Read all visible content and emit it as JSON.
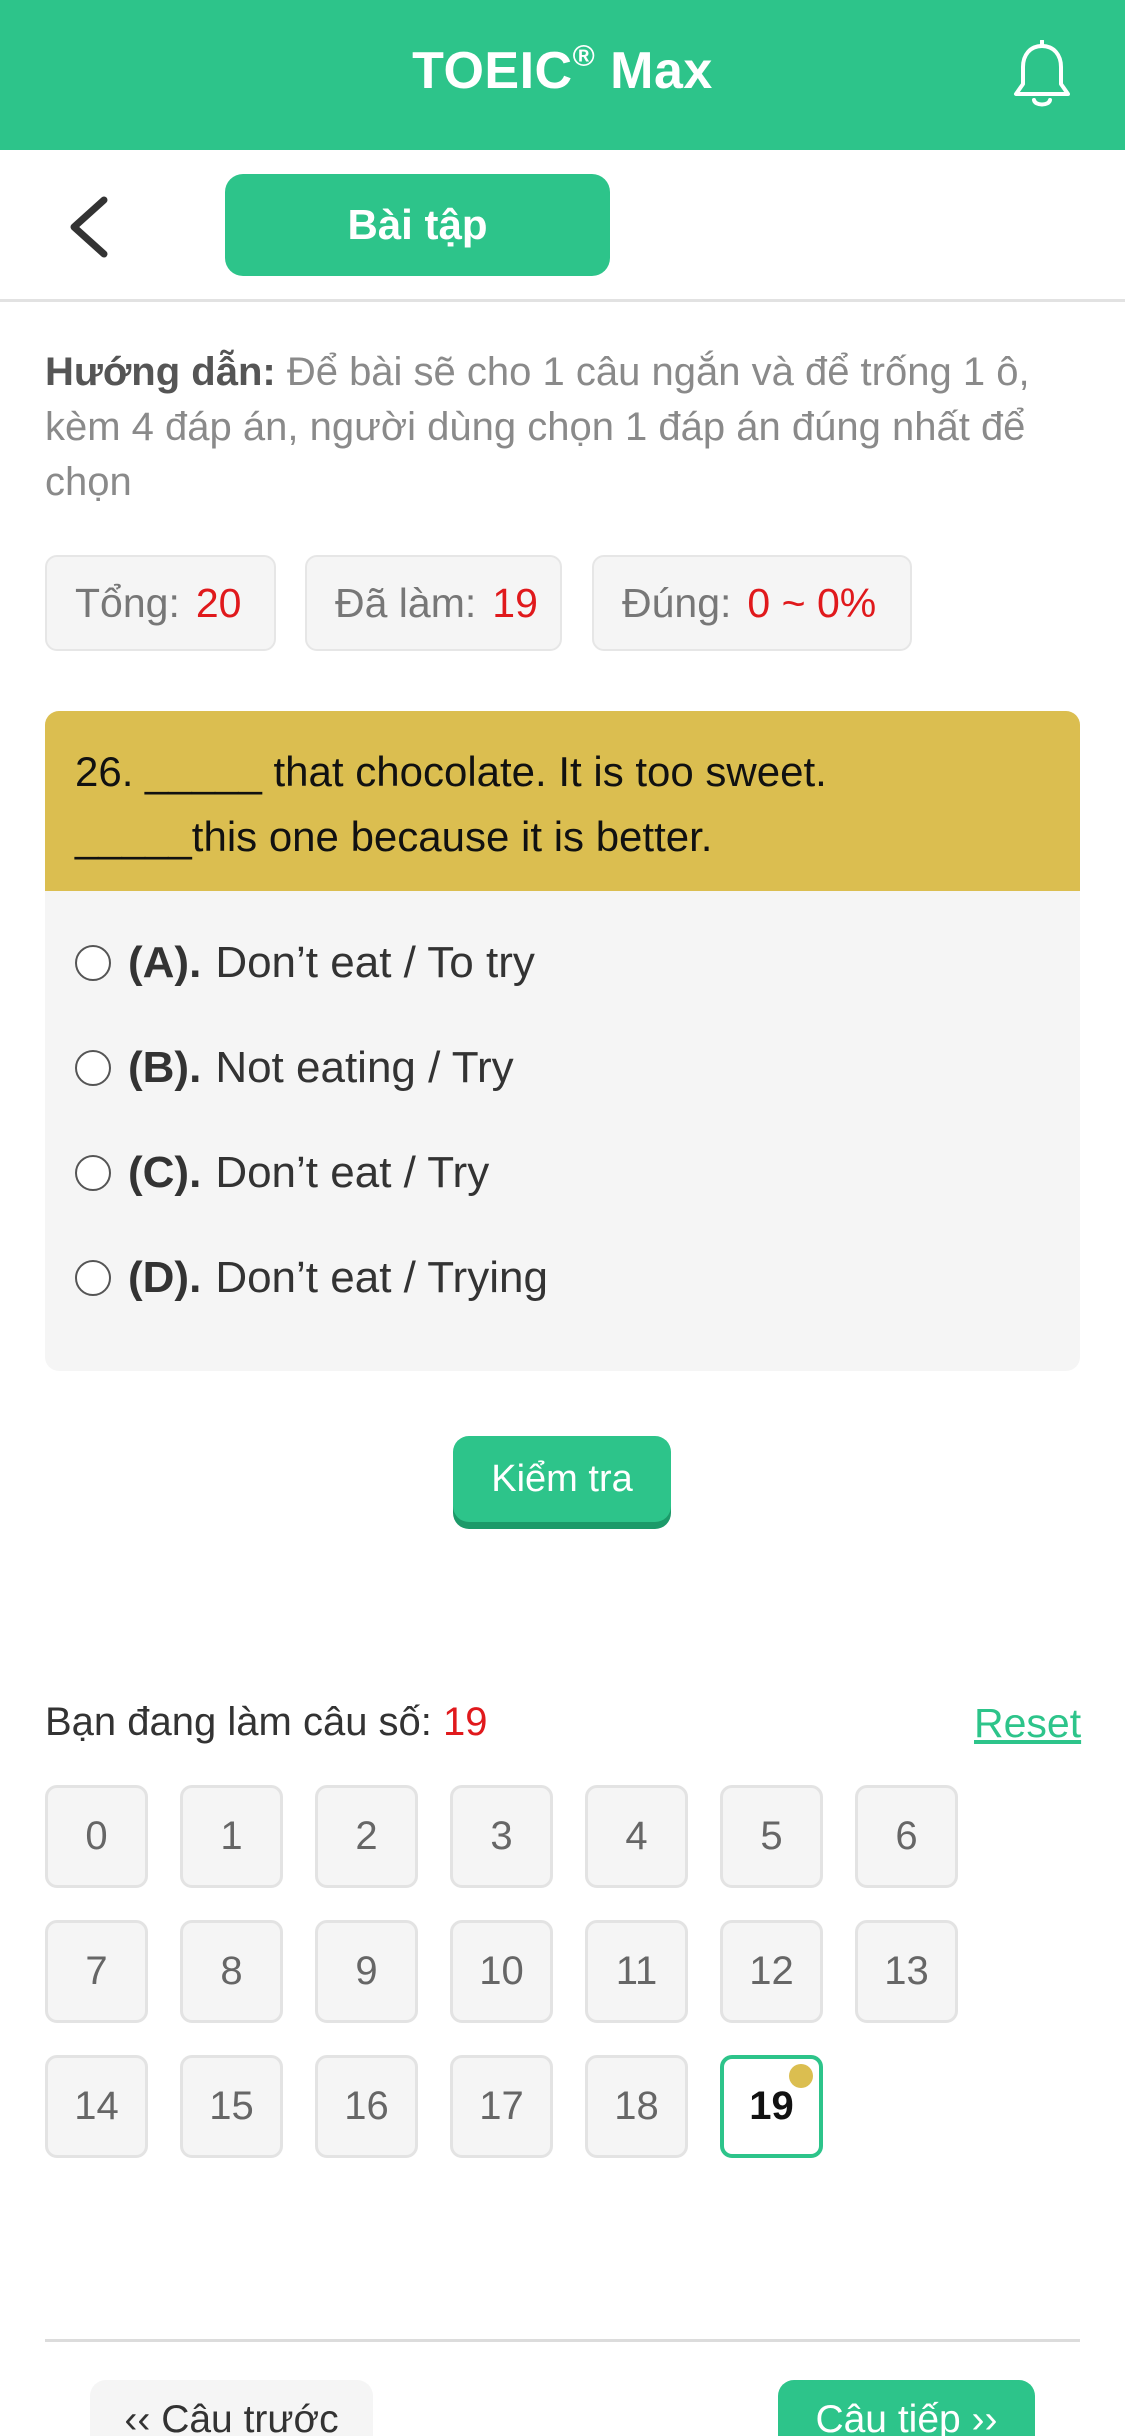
{
  "header": {
    "title": "TOEIC",
    "title_mark": "®",
    "title_suffix": " Max",
    "bell_icon": "bell-icon"
  },
  "subbar": {
    "back_icon": "chevron-left-icon",
    "tab_label": "Bài tập"
  },
  "guide": {
    "label": "Hướng dẫn:",
    "text": " Để bài sẽ cho 1 câu ngắn và để trống 1 ô, kèm 4 đáp án, người dùng chọn 1 đáp án đúng nhất để chọn"
  },
  "stats": {
    "total_label": "Tổng:",
    "total_value": "20",
    "done_label": "Đã làm:",
    "done_value": "19",
    "correct_label": "Đúng:",
    "correct_value": "0 ~ 0%"
  },
  "question": {
    "line1": "26. _____ that chocolate. It is too sweet.",
    "line2": "_____this one because it is better."
  },
  "answers": [
    {
      "label": "(A).",
      "text": "Don’t eat / To try"
    },
    {
      "label": "(B).",
      "text": "Not eating / Try"
    },
    {
      "label": "(C).",
      "text": "Don’t eat / Try"
    },
    {
      "label": "(D).",
      "text": "Don’t eat / Trying"
    }
  ],
  "check_button": "Kiểm tra",
  "progress": {
    "label": "Bạn đang làm câu số: ",
    "current": "19",
    "reset": "Reset"
  },
  "question_numbers": [
    "0",
    "1",
    "2",
    "3",
    "4",
    "5",
    "6",
    "7",
    "8",
    "9",
    "10",
    "11",
    "12",
    "13",
    "14",
    "15",
    "16",
    "17",
    "18",
    "19"
  ],
  "active_number": "19",
  "colors": {
    "brand_green": "#2dc48a",
    "question_bg": "#dbbe50",
    "highlight_red": "#e0191c"
  },
  "nav": {
    "prev": "‹‹ Câu trước",
    "next": "Câu tiếp ››"
  }
}
